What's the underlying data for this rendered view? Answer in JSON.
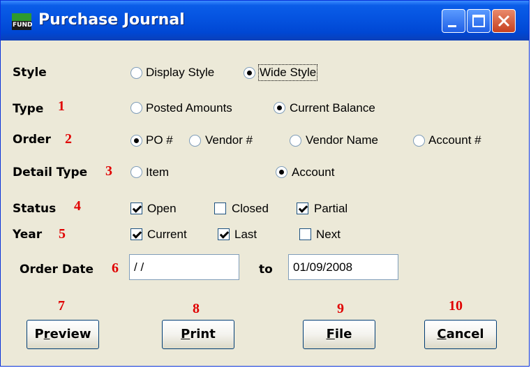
{
  "window": {
    "title": "Purchase Journal",
    "icon_text": "FUND",
    "controls": [
      "minimize",
      "maximize",
      "close"
    ]
  },
  "form": {
    "style": {
      "label": "Style",
      "options": [
        {
          "label": "Display Style",
          "selected": false
        },
        {
          "label": "Wide Style",
          "selected": true
        }
      ]
    },
    "type": {
      "label": "Type",
      "marker": "1",
      "options": [
        {
          "label": "Posted Amounts",
          "selected": false
        },
        {
          "label": "Current Balance",
          "selected": true
        }
      ]
    },
    "order": {
      "label": "Order",
      "marker": "2",
      "options": [
        {
          "label": "PO #",
          "selected": true
        },
        {
          "label": "Vendor #",
          "selected": false
        },
        {
          "label": "Vendor Name",
          "selected": false
        },
        {
          "label": "Account #",
          "selected": false
        }
      ]
    },
    "detail_type": {
      "label": "Detail Type",
      "marker": "3",
      "options": [
        {
          "label": "Item",
          "selected": false
        },
        {
          "label": "Account",
          "selected": true
        }
      ]
    },
    "status": {
      "label": "Status",
      "marker": "4",
      "options": [
        {
          "label": "Open",
          "checked": true
        },
        {
          "label": "Closed",
          "checked": false
        },
        {
          "label": "Partial",
          "checked": true
        }
      ]
    },
    "year": {
      "label": "Year",
      "marker": "5",
      "options": [
        {
          "label": "Current",
          "checked": true
        },
        {
          "label": "Last",
          "checked": true
        },
        {
          "label": "Next",
          "checked": false
        }
      ]
    },
    "order_date": {
      "label": "Order Date",
      "marker": "6",
      "from_value": " / /",
      "to_label": "to",
      "to_value": "01/09/2008"
    }
  },
  "buttons": [
    {
      "marker": "7",
      "pre": "P",
      "mnemonic": "r",
      "post": "eview"
    },
    {
      "marker": "8",
      "pre": "",
      "mnemonic": "P",
      "post": "rint"
    },
    {
      "marker": "9",
      "pre": "",
      "mnemonic": "F",
      "post": "ile"
    },
    {
      "marker": "10",
      "pre": "",
      "mnemonic": "C",
      "post": "ancel"
    }
  ],
  "colors": {
    "titlebar": "#0553e0",
    "window_bg": "#ece9d8",
    "marker": "#e00000"
  }
}
